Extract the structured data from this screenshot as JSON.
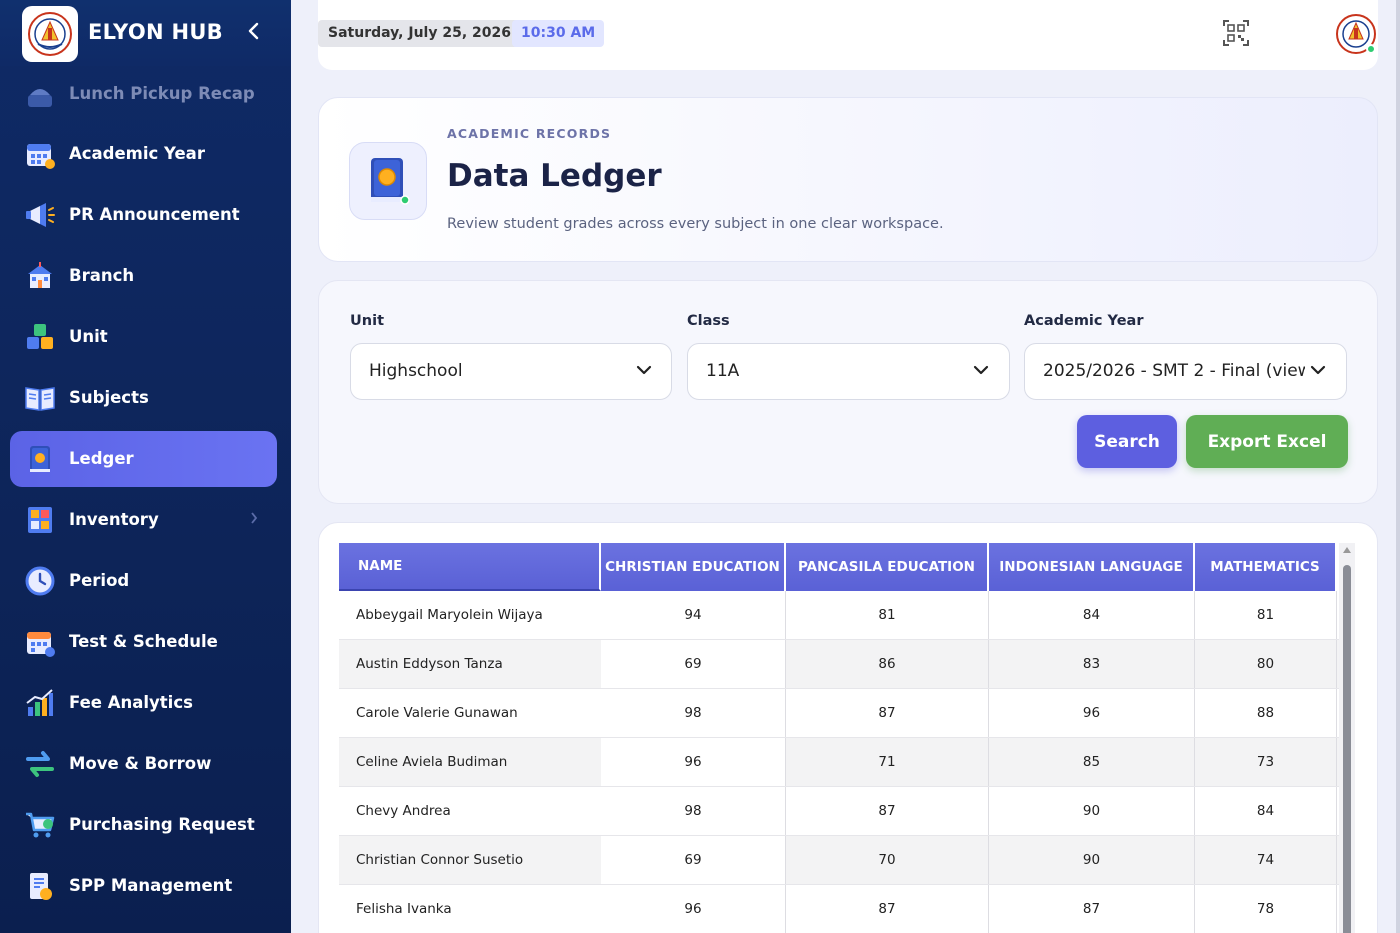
{
  "brand": {
    "title": "ELYON HUB"
  },
  "sidebar": {
    "items": [
      {
        "label": "Lunch Pickup Recap",
        "icon": "lunch-icon"
      },
      {
        "label": "Academic Year",
        "icon": "calendar-icon"
      },
      {
        "label": "PR Announcement",
        "icon": "megaphone-icon"
      },
      {
        "label": "Branch",
        "icon": "school-building-icon"
      },
      {
        "label": "Unit",
        "icon": "cubes-icon"
      },
      {
        "label": "Subjects",
        "icon": "book-open-icon"
      },
      {
        "label": "Ledger",
        "icon": "ledger-book-icon"
      },
      {
        "label": "Inventory",
        "icon": "inventory-icon"
      },
      {
        "label": "Period",
        "icon": "clock-icon"
      },
      {
        "label": "Test & Schedule",
        "icon": "schedule-calendar-icon"
      },
      {
        "label": "Fee Analytics",
        "icon": "chart-icon"
      },
      {
        "label": "Move & Borrow",
        "icon": "swap-arrows-icon"
      },
      {
        "label": "Purchasing Request",
        "icon": "cart-icon"
      },
      {
        "label": "SPP Management",
        "icon": "bill-icon"
      }
    ]
  },
  "topbar": {
    "date": "Saturday, July 25, 2026",
    "time": "10:30 AM"
  },
  "header": {
    "eyebrow": "ACADEMIC RECORDS",
    "title": "Data Ledger",
    "subtitle": "Review student grades across every subject in one clear workspace."
  },
  "filters": {
    "unit_label": "Unit",
    "unit_value": "Highschool",
    "class_label": "Class",
    "class_value": "11A",
    "year_label": "Academic Year",
    "year_value": "2025/2026 - SMT 2 - Final (view",
    "search_label": "Search",
    "export_label": "Export Excel"
  },
  "table": {
    "columns": [
      "NAME",
      "CHRISTIAN EDUCATION",
      "PANCASILA EDUCATION",
      "INDONESIAN LANGUAGE",
      "MATHEMATICS"
    ],
    "rows": [
      [
        "Abbeygail Maryolein Wijaya",
        "94",
        "81",
        "84",
        "81"
      ],
      [
        "Austin Eddyson Tanza",
        "69",
        "86",
        "83",
        "80"
      ],
      [
        "Carole Valerie Gunawan",
        "98",
        "87",
        "96",
        "88"
      ],
      [
        "Celine Aviela Budiman",
        "96",
        "71",
        "85",
        "73"
      ],
      [
        "Chevy Andrea",
        "98",
        "87",
        "90",
        "84"
      ],
      [
        "Christian Connor Susetio",
        "69",
        "70",
        "90",
        "74"
      ],
      [
        "Felisha Ivanka",
        "96",
        "87",
        "87",
        "78"
      ]
    ]
  },
  "colors": {
    "sidebar_bg": "#0f2a66",
    "accent": "#5d5fe0",
    "export": "#60ae55",
    "header_row": "#5a61d6"
  }
}
